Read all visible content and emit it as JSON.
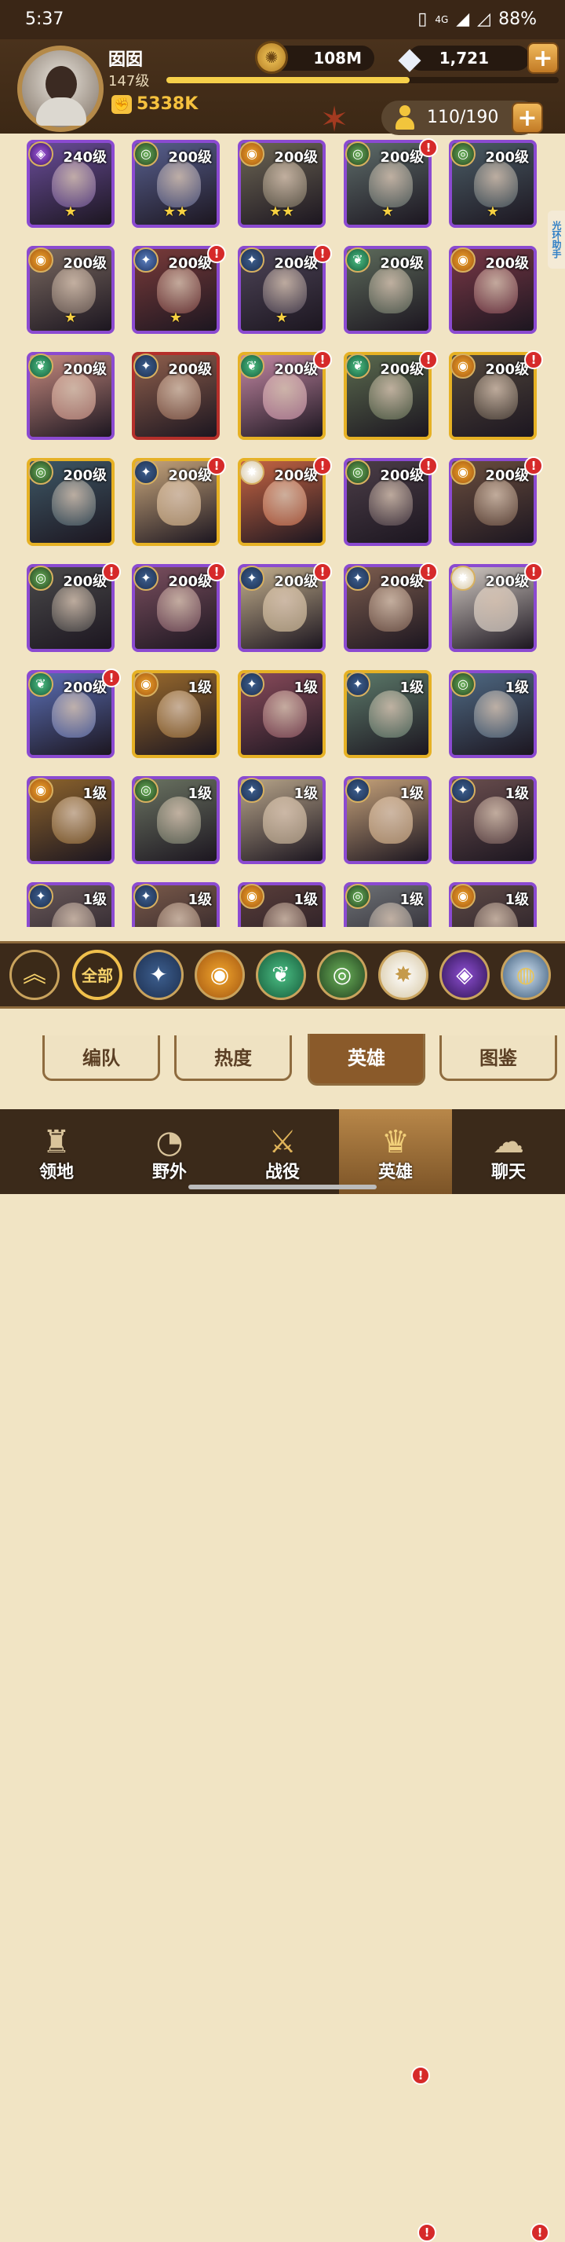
{
  "status_bar": {
    "time": "5:37",
    "network": "4G",
    "battery": "88%"
  },
  "player": {
    "name": "囡囡",
    "level": "147级",
    "power": "5338K",
    "xp_fraction": 0.62
  },
  "resources": {
    "gold": "108M",
    "gems": "1,721"
  },
  "roster": {
    "count": "110/190"
  },
  "side_helper": "光环助手",
  "heroes": [
    {
      "level": "240级",
      "faction": "shadow",
      "frame": "purple",
      "stars": "★",
      "alert": false,
      "tint": "#6a4d9a"
    },
    {
      "level": "200级",
      "faction": "eye",
      "frame": "purple",
      "stars": "★★",
      "alert": false,
      "tint": "#58608f"
    },
    {
      "level": "200级",
      "faction": "sun",
      "frame": "purple",
      "stars": "★★",
      "alert": false,
      "tint": "#6d6654"
    },
    {
      "level": "200级",
      "faction": "eye",
      "frame": "purple",
      "stars": "★",
      "alert": true,
      "tint": "#5e6d6a"
    },
    {
      "level": "200级",
      "faction": "eye",
      "frame": "purple",
      "stars": "★",
      "alert": false,
      "tint": "#4b5d66"
    },
    {
      "level": "200级",
      "faction": "sun",
      "frame": "purple",
      "stars": "★",
      "alert": false,
      "tint": "#7a6960"
    },
    {
      "level": "200级",
      "faction": "clock",
      "frame": "purple",
      "stars": "★",
      "alert": true,
      "tint": "#7a3b3a"
    },
    {
      "level": "200级",
      "faction": "star",
      "frame": "purple",
      "stars": "★",
      "alert": true,
      "tint": "#4e4558"
    },
    {
      "level": "200级",
      "faction": "leaf",
      "frame": "purple",
      "stars": "",
      "alert": false,
      "tint": "#5d6b5b"
    },
    {
      "level": "200级",
      "faction": "sun",
      "frame": "purple",
      "stars": "",
      "alert": false,
      "tint": "#7a3846"
    },
    {
      "level": "200级",
      "faction": "leaf",
      "frame": "purple",
      "stars": "",
      "alert": false,
      "tint": "#c68a7f"
    },
    {
      "level": "200级",
      "faction": "star",
      "frame": "red",
      "stars": "",
      "alert": false,
      "tint": "#8f5f4c"
    },
    {
      "level": "200级",
      "faction": "leaf",
      "frame": "gold",
      "stars": "",
      "alert": true,
      "tint": "#c488a4"
    },
    {
      "level": "200级",
      "faction": "leaf",
      "frame": "gold",
      "stars": "",
      "alert": true,
      "tint": "#5a6a4e"
    },
    {
      "level": "200级",
      "faction": "sun",
      "frame": "gold",
      "stars": "",
      "alert": true,
      "tint": "#52473c"
    },
    {
      "level": "200级",
      "faction": "eye",
      "frame": "gold",
      "stars": "",
      "alert": false,
      "tint": "#3e5866"
    },
    {
      "level": "200级",
      "faction": "star",
      "frame": "gold",
      "stars": "",
      "alert": true,
      "tint": "#c9a77c"
    },
    {
      "level": "200级",
      "faction": "light",
      "frame": "gold",
      "stars": "",
      "alert": true,
      "tint": "#c76543"
    },
    {
      "level": "200级",
      "faction": "eye",
      "frame": "purple",
      "stars": "",
      "alert": true,
      "tint": "#4c3e48"
    },
    {
      "level": "200级",
      "faction": "sun",
      "frame": "purple",
      "stars": "",
      "alert": true,
      "tint": "#6b4e3e"
    },
    {
      "level": "200级",
      "faction": "eye",
      "frame": "purple",
      "stars": "",
      "alert": true,
      "tint": "#4a4a4a"
    },
    {
      "level": "200级",
      "faction": "star",
      "frame": "purple",
      "stars": "",
      "alert": true,
      "tint": "#7b4f5f"
    },
    {
      "level": "200级",
      "faction": "star",
      "frame": "purple",
      "stars": "",
      "alert": true,
      "tint": "#c4b08d"
    },
    {
      "level": "200级",
      "faction": "star",
      "frame": "purple",
      "stars": "",
      "alert": true,
      "tint": "#7d5d4e"
    },
    {
      "level": "200级",
      "faction": "light",
      "frame": "purple",
      "stars": "",
      "alert": true,
      "tint": "#d1c9c2"
    },
    {
      "level": "200级",
      "faction": "leaf",
      "frame": "purple",
      "stars": "",
      "alert": true,
      "tint": "#5b6fb5"
    },
    {
      "level": "1级",
      "faction": "sun",
      "frame": "gold",
      "stars": "",
      "alert": false,
      "tint": "#9a6a2c"
    },
    {
      "level": "1级",
      "faction": "star",
      "frame": "gold",
      "stars": "",
      "alert": false,
      "tint": "#8a4b5b"
    },
    {
      "level": "1级",
      "faction": "star",
      "frame": "gold",
      "stars": "",
      "alert": false,
      "tint": "#5c7a6a"
    },
    {
      "level": "1级",
      "faction": "eye",
      "frame": "purple",
      "stars": "",
      "alert": false,
      "tint": "#4f6a84"
    },
    {
      "level": "1级",
      "faction": "sun",
      "frame": "purple",
      "stars": "",
      "alert": false,
      "tint": "#8e642c"
    },
    {
      "level": "1级",
      "faction": "eye",
      "frame": "purple",
      "stars": "",
      "alert": false,
      "tint": "#6b7462"
    },
    {
      "level": "1级",
      "faction": "star",
      "frame": "purple",
      "stars": "",
      "alert": false,
      "tint": "#b8a58a"
    },
    {
      "level": "1级",
      "faction": "star",
      "frame": "purple",
      "stars": "",
      "alert": false,
      "tint": "#c6a27a"
    },
    {
      "level": "1级",
      "faction": "star",
      "frame": "purple",
      "stars": "",
      "alert": false,
      "tint": "#6a4e4e"
    },
    {
      "level": "1级",
      "faction": "star",
      "frame": "purple",
      "stars": "",
      "alert": false,
      "tint": "#6a5a5a"
    },
    {
      "level": "1级",
      "faction": "star",
      "frame": "purple",
      "stars": "",
      "alert": false,
      "tint": "#7a5a4a"
    },
    {
      "level": "1级",
      "faction": "sun",
      "frame": "purple",
      "stars": "",
      "alert": false,
      "tint": "#5a3e3a"
    },
    {
      "level": "1级",
      "faction": "eye",
      "frame": "purple",
      "stars": "",
      "alert": false,
      "tint": "#6e7276"
    },
    {
      "level": "1级",
      "faction": "sun",
      "frame": "purple",
      "stars": "",
      "alert": false,
      "tint": "#5e4a46"
    }
  ],
  "filters": {
    "all": "全部"
  },
  "tabs": [
    "编队",
    "热度",
    "英雄",
    "图鉴"
  ],
  "nav": [
    "领地",
    "野外",
    "战役",
    "英雄",
    "聊天"
  ],
  "colors": {
    "accent": "#f0c04c",
    "alert": "#d62a2a",
    "purple_frame": "#8b4ad1",
    "gold_frame": "#e6b124",
    "red_frame": "#b52f2a"
  }
}
